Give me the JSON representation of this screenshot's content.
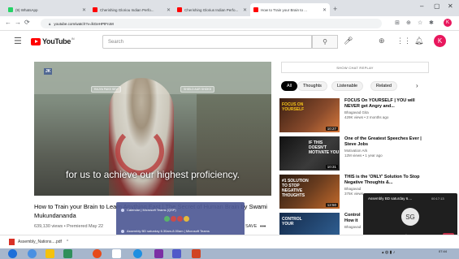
{
  "browser": {
    "tabs": [
      {
        "label": "(9) WhatsApp",
        "color": "#25d366"
      },
      {
        "label": "Cherishing Gloriou Indian Perfo...",
        "color": "#ff0000"
      },
      {
        "label": "Cherishing Glorius Indian Perfo...",
        "color": "#ff0000"
      },
      {
        "label": "How to Train your Brain to ...",
        "color": "#ff0000"
      }
    ],
    "new_tab": "+",
    "url": "youtube.com/watch?v=lkGeHPtFroM",
    "profile_initial": "K"
  },
  "youtube": {
    "logo_text": "YouTube",
    "logo_region": "IN",
    "search_placeholder": "Search",
    "avatar_initial": "K",
    "video": {
      "caption": "for us to achieve our highest proficiency.",
      "logo": "JK",
      "tags": [
        "RAJYA PAKS SEV",
        "SHIELD AUR SHOKS"
      ],
      "title": "How to Train your Brain to Learn Anything Fast | The Secret of Human Brain by Swami Mukundananda",
      "views": "639,130 views • Premiered May 22",
      "save": "SAVE",
      "more": "•••"
    },
    "chat_replay": "SHOW CHAT REPLAY",
    "chips": [
      "All",
      "Thoughts",
      "Listenable",
      "Related"
    ],
    "recommendations": [
      {
        "thumb_text": "FOCUS ON YOURSELF",
        "duration": "10:27",
        "title": "FOCUS On YOURSELF | YOU will NEVER get Angry and...",
        "channel": "Bhagavad Gita",
        "views": "429K views • 2 months ago"
      },
      {
        "thumb_text": "IF THIS DOESN'T MOTIVATE YOU",
        "duration": "10:31",
        "title": "One of the Greatest Speeches Ever | Steve Jobs",
        "channel": "Motivation Ark",
        "views": "12M views • 1 year ago"
      },
      {
        "thumb_text": "#1 SOLUTION TO STOP NEGATIVE THOUGHTS",
        "duration": "12:50",
        "title": "THIS is the 'ONLY' Solution To Stop Negative Thoughts &...",
        "channel": "Bhagavad",
        "views": "375K views"
      },
      {
        "thumb_text": "CONTROL YOUR",
        "duration": "",
        "title": "Control How it",
        "channel": "Bhagavad",
        "views": "1M views"
      }
    ]
  },
  "teams_notification": {
    "line1": "Calendar | Microsoft Teams (QSP)",
    "line2": "Assembly BD saturday 6.30am-8.00am | Microsoft Teams",
    "line3": "Microsoft Teams Call in progress Meeting in \"General\""
  },
  "teams_call": {
    "title": "Assembly BD saturday 6....",
    "time": "00:17:13",
    "initials": "SG"
  },
  "download": {
    "filename": "Assembly_Nations....pdf",
    "caret": "^"
  },
  "taskbar": {
    "time": "07:44"
  }
}
